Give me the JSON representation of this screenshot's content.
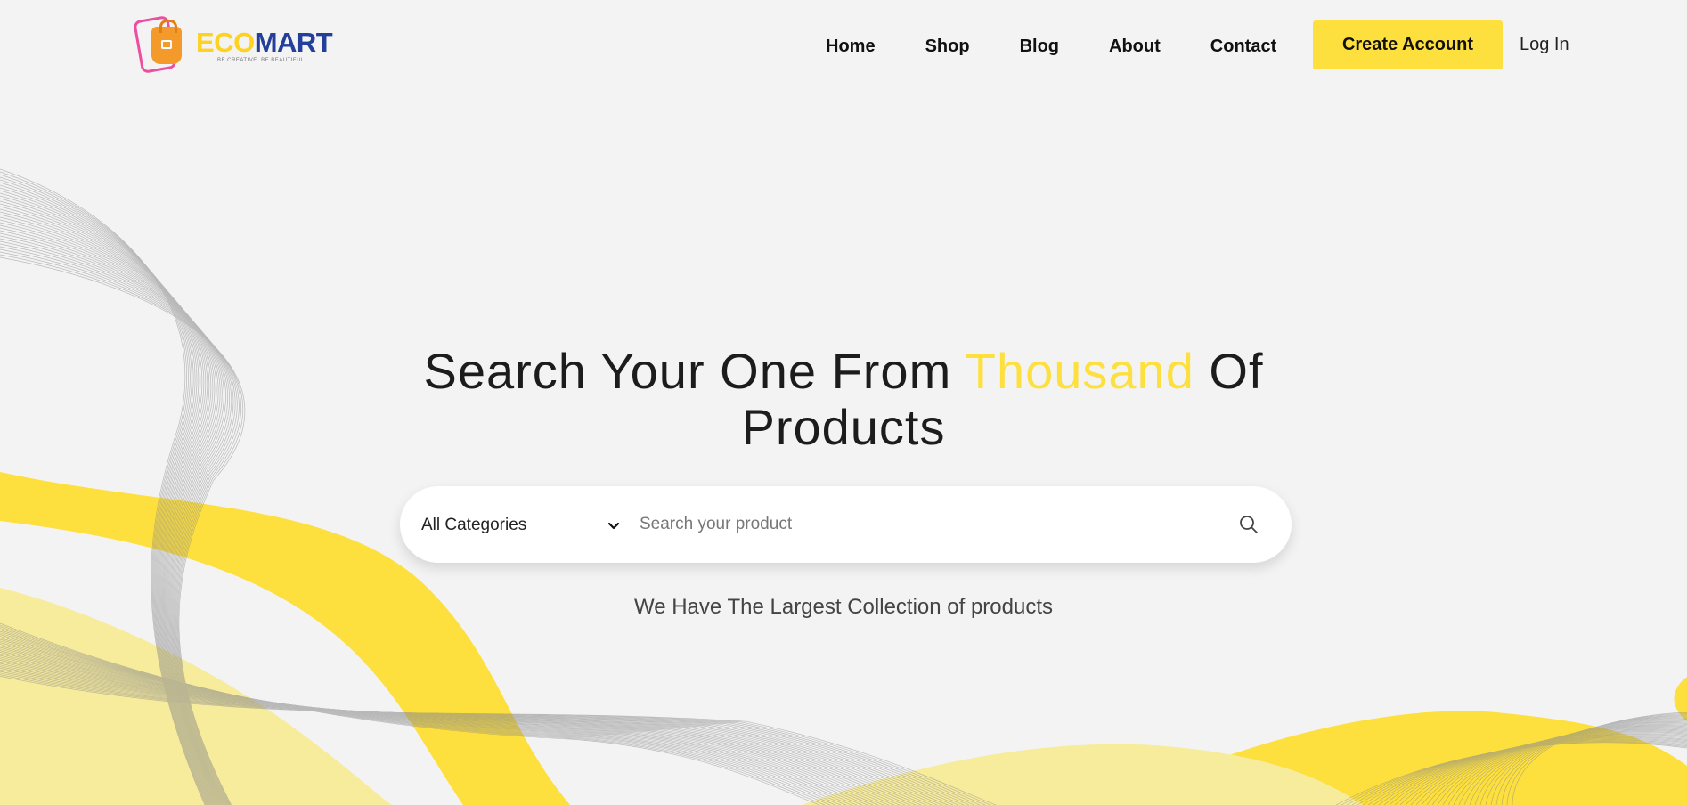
{
  "brand": {
    "name_part1": "ECO",
    "name_part2": "MART",
    "tagline": "BE CREATIVE.  BE BEAUTIFUL.",
    "colors": {
      "eco": "#ffd21f",
      "mart": "#243f9a",
      "accent": "#fddf3e"
    },
    "logo_icon": "shopping-bag-phone-icon"
  },
  "nav": {
    "items": [
      {
        "label": "Home"
      },
      {
        "label": "Shop"
      },
      {
        "label": "Blog"
      },
      {
        "label": "About"
      },
      {
        "label": "Contact"
      }
    ],
    "create_account": "Create Account",
    "login": "Log In"
  },
  "hero": {
    "title_before": "Search Your One From ",
    "title_highlight": "Thousand",
    "title_after_1": " Of",
    "title_after_2": "Products",
    "subtitle": "We Have The Largest Collection of products"
  },
  "search": {
    "category_selected": "All Categories",
    "placeholder": "Search your product",
    "value": "",
    "icons": {
      "dropdown": "chevron-down-icon",
      "submit": "search-icon"
    }
  },
  "colors": {
    "background": "#f3f3f3",
    "yellow": "#fddf3e",
    "light_yellow": "#f6e88c",
    "wave_lines": "#8a8a8a"
  }
}
